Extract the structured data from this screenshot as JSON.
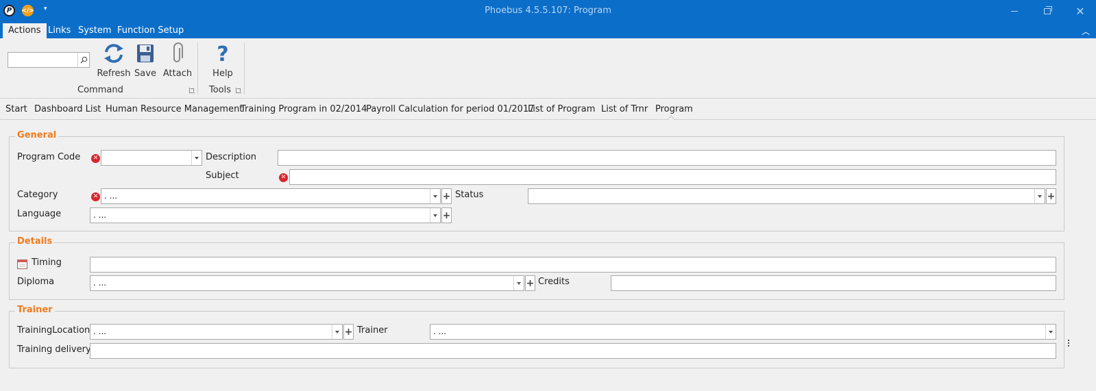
{
  "window": {
    "title": "Phoebus 4.5.5.107: Program"
  },
  "menu": {
    "tabs": [
      "Actions",
      "Links",
      "System",
      "Function Setup"
    ]
  },
  "ribbon": {
    "search_value": "",
    "buttons": {
      "refresh": "Refresh",
      "save": "Save",
      "attach": "Attach",
      "help": "Help"
    },
    "groups": {
      "command": "Command",
      "tools": "Tools"
    }
  },
  "breadcrumb": [
    "Start",
    "Dashboard List",
    "Human Resource Management",
    "Training Program in 02/2014",
    "Payroll Calculation for period 01/2017",
    "List of Program",
    "List of Trnr",
    "Program"
  ],
  "general": {
    "legend": "General",
    "program_code_label": "Program Code",
    "program_code_value": "",
    "description_label": "Description",
    "description_value": "",
    "subject_label": "Subject",
    "subject_value": "",
    "category_label": "Category",
    "category_value": ". ...",
    "status_label": "Status",
    "status_value": "",
    "language_label": "Language",
    "language_value": ". ..."
  },
  "details": {
    "legend": "Details",
    "timing_label": "Timing",
    "timing_value": "",
    "diploma_label": "Diploma",
    "diploma_value": ". ...",
    "credits_label": "Credits",
    "credits_value": ""
  },
  "trainer": {
    "legend": "Trainer",
    "location_label": "TrainingLocation",
    "location_value": ". ...",
    "trainer_label": "Trainer",
    "trainer_value": ". ...",
    "delivery_label": "Training delivery",
    "delivery_value": ""
  },
  "colors": {
    "titlebar": "#0b6ec9",
    "legend": "#ee7c1e",
    "required": "#d8262d",
    "icon_blue": "#2f6db5"
  }
}
